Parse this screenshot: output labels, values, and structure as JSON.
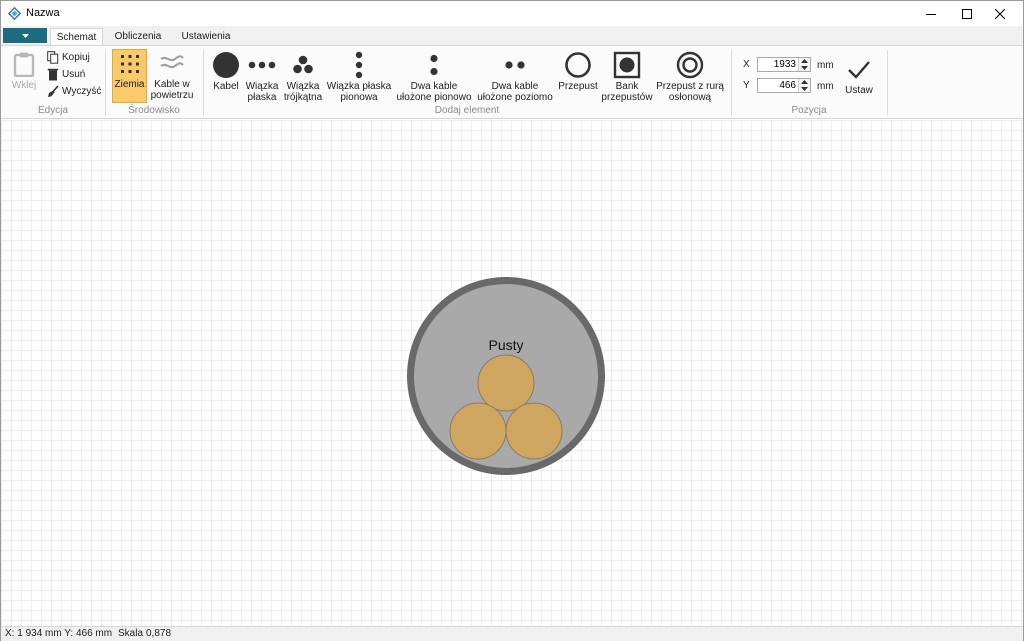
{
  "window": {
    "title": "Nazwa",
    "controls": [
      "minimize-icon",
      "maximize-icon",
      "close-icon"
    ]
  },
  "ribbon": {
    "tabs": [
      {
        "label": "Schemat",
        "active": true
      },
      {
        "label": "Obliczenia",
        "active": false
      },
      {
        "label": "Ustawienia",
        "active": false
      }
    ],
    "groups": {
      "edycja": {
        "label": "Edycja",
        "paste": "Wklej",
        "copy": "Kopiuj",
        "delete": "Usuń",
        "clear": "Wyczyść"
      },
      "srodowisko": {
        "label": "Środowisko",
        "ground": "Ziemia",
        "air_line1": "Kable w",
        "air_line2": "powietrzu"
      },
      "dodaj": {
        "label": "Dodaj element",
        "items": [
          {
            "line1": "Kabel",
            "line2": ""
          },
          {
            "line1": "Wiązka",
            "line2": "płaska"
          },
          {
            "line1": "Wiązka",
            "line2": "trójkątna"
          },
          {
            "line1": "Wiązka płaska",
            "line2": "pionowa"
          },
          {
            "line1": "Dwa kable",
            "line2": "ułożone pionowo"
          },
          {
            "line1": "Dwa kable",
            "line2": "ułożone poziomo"
          },
          {
            "line1": "Przepust",
            "line2": ""
          },
          {
            "line1": "Bank",
            "line2": "przepustów"
          },
          {
            "line1": "Przepust z rurą",
            "line2": "osłonową"
          }
        ]
      },
      "pozycja": {
        "label": "Pozycja",
        "x_label": "X",
        "y_label": "Y",
        "x_value": "1933",
        "y_value": "466",
        "unit": "mm",
        "apply": "Ustaw"
      }
    }
  },
  "canvas": {
    "element_label": "Pusty",
    "colors": {
      "duct_outer": "#696969",
      "duct_inner": "#a9a9a9",
      "cable_fill": "#cfa660",
      "cable_stroke": "#8a7a60"
    }
  },
  "statusbar": {
    "coords": "X:  1 934 mm Y: 466 mm",
    "scale_label": "Skala",
    "scale_value": "0,878"
  }
}
